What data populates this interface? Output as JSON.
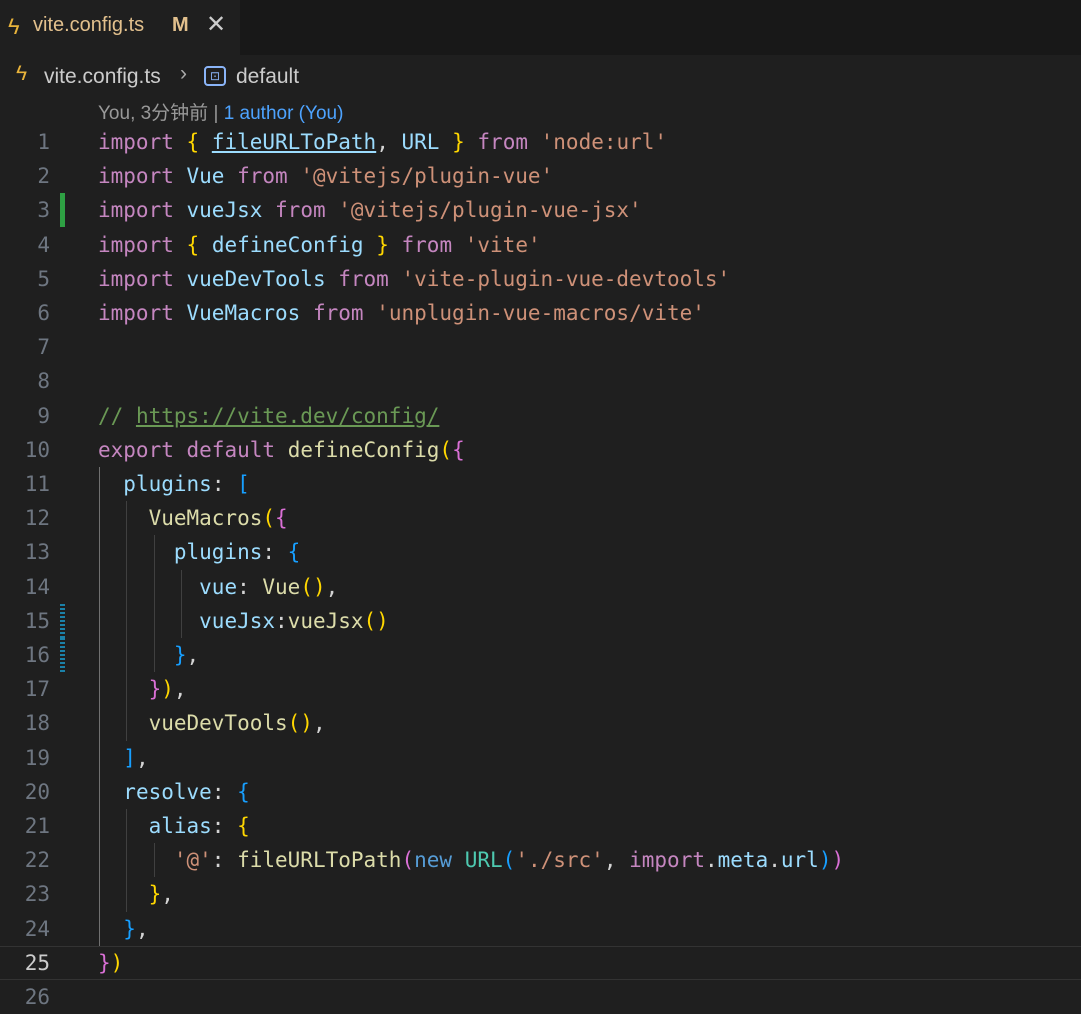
{
  "tab": {
    "icon": "lightning-icon",
    "title": "vite.config.ts",
    "modified_badge": "M",
    "close": "✕"
  },
  "breadcrumb": {
    "file": "vite.config.ts",
    "symbol": "default"
  },
  "codelens": {
    "blame": "You, 3分钟前 | ",
    "authors": "1 author (You)"
  },
  "editor": {
    "current_line": 25,
    "line_numbers": [
      "1",
      "2",
      "3",
      "4",
      "5",
      "6",
      "7",
      "8",
      "9",
      "10",
      "11",
      "12",
      "13",
      "14",
      "15",
      "16",
      "17",
      "18",
      "19",
      "20",
      "21",
      "22",
      "23",
      "24",
      "25",
      "26"
    ],
    "lines": [
      [
        [
          "kw",
          "import"
        ],
        [
          "pl",
          " "
        ],
        [
          "b1",
          "{"
        ],
        [
          "pl",
          " "
        ],
        [
          "var link",
          "fileURLToPath"
        ],
        [
          "pl",
          ", "
        ],
        [
          "var",
          "URL"
        ],
        [
          "pl",
          " "
        ],
        [
          "b1",
          "}"
        ],
        [
          "pl",
          " "
        ],
        [
          "kw",
          "from"
        ],
        [
          "pl",
          " "
        ],
        [
          "str",
          "'node:url'"
        ]
      ],
      [
        [
          "kw",
          "import"
        ],
        [
          "pl",
          " "
        ],
        [
          "var",
          "Vue"
        ],
        [
          "pl",
          " "
        ],
        [
          "kw",
          "from"
        ],
        [
          "pl",
          " "
        ],
        [
          "str",
          "'@vitejs/plugin-vue'"
        ]
      ],
      [
        [
          "kw",
          "import"
        ],
        [
          "pl",
          " "
        ],
        [
          "var",
          "vueJsx"
        ],
        [
          "pl",
          " "
        ],
        [
          "kw",
          "from"
        ],
        [
          "pl",
          " "
        ],
        [
          "str",
          "'@vitejs/plugin-vue-jsx'"
        ]
      ],
      [
        [
          "kw",
          "import"
        ],
        [
          "pl",
          " "
        ],
        [
          "b1",
          "{"
        ],
        [
          "pl",
          " "
        ],
        [
          "var",
          "defineConfig"
        ],
        [
          "pl",
          " "
        ],
        [
          "b1",
          "}"
        ],
        [
          "pl",
          " "
        ],
        [
          "kw",
          "from"
        ],
        [
          "pl",
          " "
        ],
        [
          "str",
          "'vite'"
        ]
      ],
      [
        [
          "kw",
          "import"
        ],
        [
          "pl",
          " "
        ],
        [
          "var",
          "vueDevTools"
        ],
        [
          "pl",
          " "
        ],
        [
          "kw",
          "from"
        ],
        [
          "pl",
          " "
        ],
        [
          "str",
          "'vite-plugin-vue-devtools'"
        ]
      ],
      [
        [
          "kw",
          "import"
        ],
        [
          "pl",
          " "
        ],
        [
          "var",
          "VueMacros"
        ],
        [
          "pl",
          " "
        ],
        [
          "kw",
          "from"
        ],
        [
          "pl",
          " "
        ],
        [
          "str",
          "'unplugin-vue-macros/vite'"
        ]
      ],
      [],
      [],
      [
        [
          "cm",
          "// "
        ],
        [
          "url",
          "https://vite.dev/config/"
        ]
      ],
      [
        [
          "kw",
          "export"
        ],
        [
          "pl",
          " "
        ],
        [
          "kw",
          "default"
        ],
        [
          "pl",
          " "
        ],
        [
          "fn",
          "defineConfig"
        ],
        [
          "b1",
          "("
        ],
        [
          "b2",
          "{"
        ]
      ],
      [
        [
          "pl",
          "  "
        ],
        [
          "var",
          "plugins"
        ],
        [
          "pl",
          ": "
        ],
        [
          "b3",
          "["
        ]
      ],
      [
        [
          "pl",
          "    "
        ],
        [
          "fn",
          "VueMacros"
        ],
        [
          "b1",
          "("
        ],
        [
          "b2",
          "{"
        ]
      ],
      [
        [
          "pl",
          "      "
        ],
        [
          "var",
          "plugins"
        ],
        [
          "pl",
          ": "
        ],
        [
          "b3",
          "{"
        ]
      ],
      [
        [
          "pl",
          "        "
        ],
        [
          "var",
          "vue"
        ],
        [
          "pl",
          ": "
        ],
        [
          "fn",
          "Vue"
        ],
        [
          "b1",
          "()"
        ],
        [
          "pl",
          ","
        ]
      ],
      [
        [
          "pl",
          "        "
        ],
        [
          "var",
          "vueJsx"
        ],
        [
          "pl",
          ":"
        ],
        [
          "fn",
          "vueJsx"
        ],
        [
          "b1",
          "()"
        ]
      ],
      [
        [
          "pl",
          "      "
        ],
        [
          "b3",
          "}"
        ],
        [
          "pl",
          ","
        ]
      ],
      [
        [
          "pl",
          "    "
        ],
        [
          "b2",
          "}"
        ],
        [
          "b1",
          ")"
        ],
        [
          "pl",
          ","
        ]
      ],
      [
        [
          "pl",
          "    "
        ],
        [
          "fn",
          "vueDevTools"
        ],
        [
          "b1",
          "()"
        ],
        [
          "pl",
          ","
        ]
      ],
      [
        [
          "pl",
          "  "
        ],
        [
          "b3",
          "]"
        ],
        [
          "pl",
          ","
        ]
      ],
      [
        [
          "pl",
          "  "
        ],
        [
          "var",
          "resolve"
        ],
        [
          "pl",
          ": "
        ],
        [
          "b3",
          "{"
        ]
      ],
      [
        [
          "pl",
          "    "
        ],
        [
          "var",
          "alias"
        ],
        [
          "pl",
          ": "
        ],
        [
          "b1",
          "{"
        ]
      ],
      [
        [
          "pl",
          "      "
        ],
        [
          "str",
          "'@'"
        ],
        [
          "pl",
          ": "
        ],
        [
          "fn",
          "fileURLToPath"
        ],
        [
          "b2",
          "("
        ],
        [
          "kw2",
          "new"
        ],
        [
          "pl",
          " "
        ],
        [
          "cls",
          "URL"
        ],
        [
          "b3",
          "("
        ],
        [
          "str",
          "'./src'"
        ],
        [
          "pl",
          ", "
        ],
        [
          "kw",
          "import"
        ],
        [
          "pl",
          "."
        ],
        [
          "var",
          "meta"
        ],
        [
          "pl",
          "."
        ],
        [
          "var",
          "url"
        ],
        [
          "b3",
          ")"
        ],
        [
          "b2",
          ")"
        ]
      ],
      [
        [
          "pl",
          "    "
        ],
        [
          "b1",
          "}"
        ],
        [
          "pl",
          ","
        ]
      ],
      [
        [
          "pl",
          "  "
        ],
        [
          "b3",
          "}"
        ],
        [
          "pl",
          ","
        ]
      ],
      [
        [
          "b2",
          "}"
        ],
        [
          "b1",
          ")"
        ]
      ],
      []
    ],
    "gutter_marks": {
      "3": "added",
      "15": "modified",
      "16": "modified"
    }
  }
}
